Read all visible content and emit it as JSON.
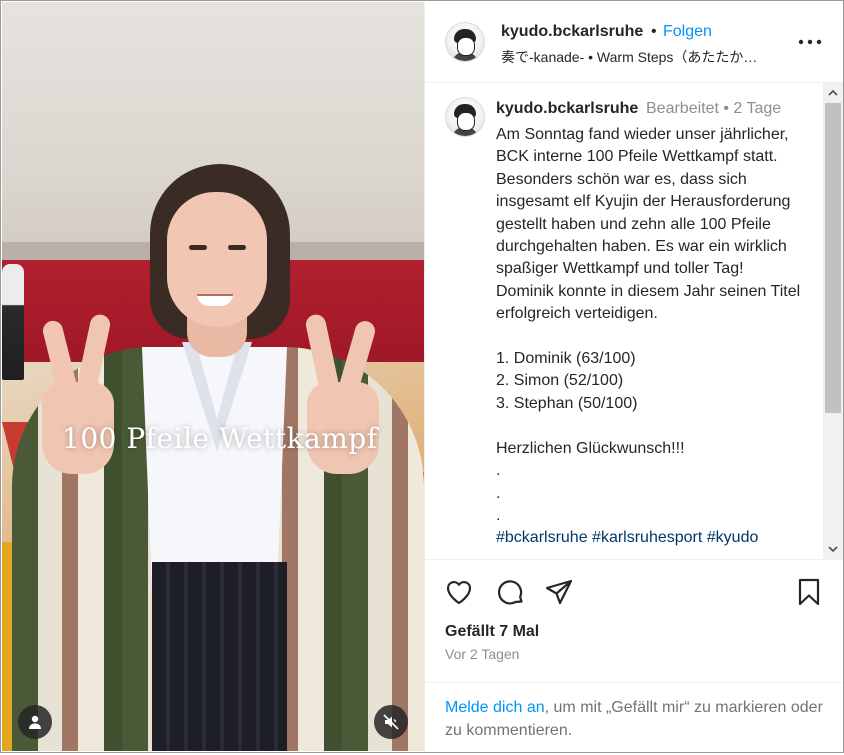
{
  "video": {
    "overlay_text": "100 Pfeile Wettkampf",
    "profile_button_icon": "user-silhouette-icon",
    "mute_button_icon": "sound-off-icon"
  },
  "header": {
    "username": "kyudo.bckarlsruhe",
    "separator": "•",
    "follow": "Folgen",
    "audio": "奏で-kanade- • Warm Steps（あたたか…"
  },
  "comment": {
    "username": "kyudo.bckarlsruhe",
    "meta": "Bearbeitet •  2 Tage",
    "caption": "Am Sonntag fand wieder unser jährlicher, BCK interne 100 Pfeile Wettkampf statt. Besonders schön war es, dass sich insgesamt elf Kyujin der Herausforderung gestellt haben und zehn alle 100 Pfeile durchgehalten haben. Es war ein wirklich spaßiger Wettkampf und toller Tag!\nDominik konnte in diesem Jahr seinen Titel erfolgreich verteidigen.\n\n1. Dominik (63/100)\n2. Simon (52/100)\n3. Stephan (50/100)\n\nHerzlichen Glückwunsch!!!\n.\n.\n.",
    "hashtags": "#bckarlsruhe #karlsruhesport #kyudo"
  },
  "stats": {
    "likes": "Gefällt 7 Mal",
    "time": "Vor 2 Tagen"
  },
  "login": {
    "link": "Melde dich an",
    "rest": ", um mit „Gefällt mir“ zu markieren oder zu kommentieren."
  },
  "colors": {
    "accent": "#0095f6",
    "text": "#262626",
    "muted": "#8e8e8e"
  }
}
